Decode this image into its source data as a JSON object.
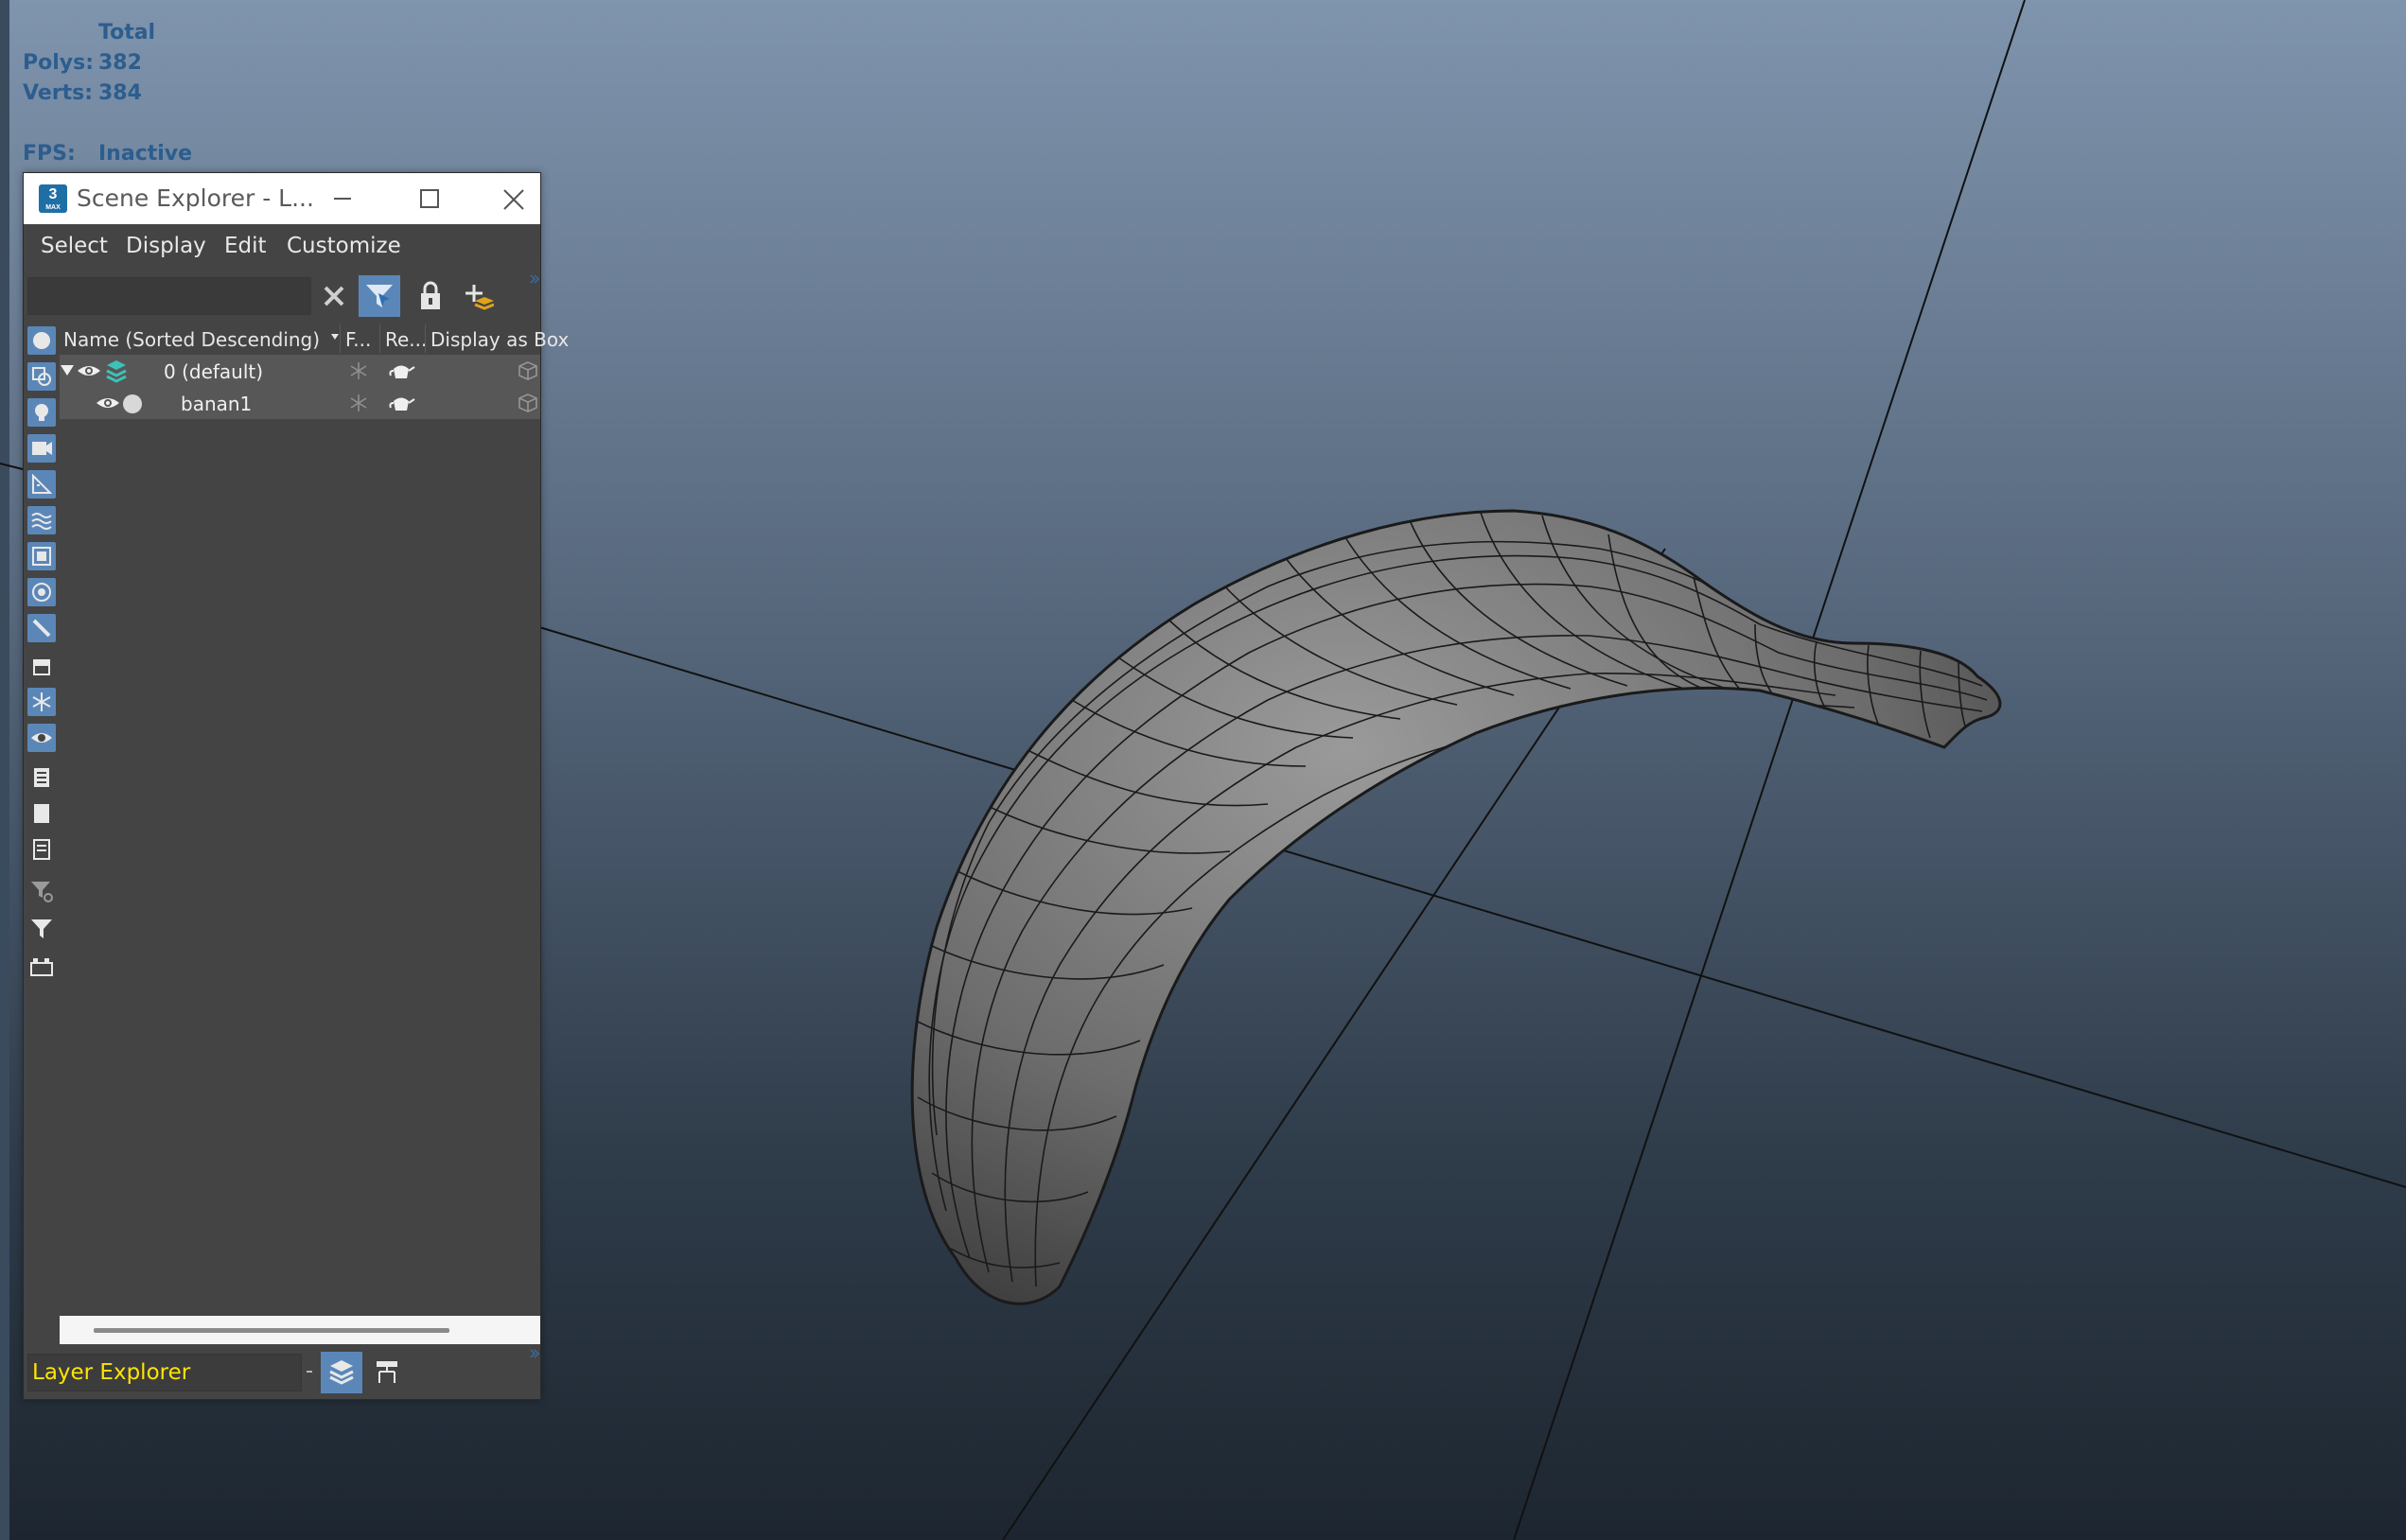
{
  "stats": {
    "header": "Total",
    "polys_label": "Polys:",
    "polys_value": "382",
    "verts_label": "Verts:",
    "verts_value": "384",
    "fps_label": "FPS:",
    "fps_value": "Inactive"
  },
  "window": {
    "app_badge": "3",
    "app_badge_sub": "MAX",
    "title": "Scene Explorer - L..."
  },
  "menu": {
    "select": "Select",
    "display": "Display",
    "edit": "Edit",
    "customize": "Customize"
  },
  "search": {
    "value": ""
  },
  "columns": {
    "name": "Name (Sorted Descending)",
    "frozen": "F...",
    "render": "Re...",
    "display_as_box": "Display as Box"
  },
  "rows": [
    {
      "name": "0 (default)"
    },
    {
      "name": "banan1"
    }
  ],
  "bottom": {
    "explorer_name": "Layer Explorer"
  },
  "colors": {
    "accent": "#5b87b8",
    "stats_text": "#2c5d8e",
    "explorer_name_text": "#ffe400",
    "panel_bg": "#444444"
  },
  "icons": {
    "window": [
      "app-icon",
      "minimize-icon",
      "maximize-icon",
      "close-icon"
    ],
    "toolbar": [
      "clear-search-icon",
      "filter-select-icon",
      "lock-icon",
      "add-layer-icon"
    ],
    "side": [
      "geometry-icon",
      "shapes-icon",
      "light-icon",
      "camera-icon",
      "helper-icon",
      "spacewarp-icon",
      "group-icon",
      "xref-icon",
      "bone-icon",
      "container-icon",
      "frozen-icon",
      "visible-icon",
      "select-all-icon",
      "select-none-icon",
      "select-invert-icon",
      "filter-settings-icon",
      "filter-icon",
      "layer-hierarchy-icon"
    ],
    "bottom": [
      "layers-mode-icon",
      "hierarchy-mode-icon"
    ]
  }
}
